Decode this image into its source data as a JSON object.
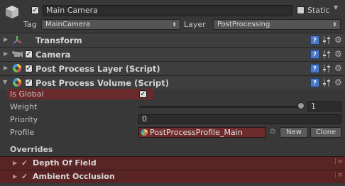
{
  "header": {
    "object_active": true,
    "object_name": "Main Camera",
    "static_label": "Static",
    "tag_label": "Tag",
    "tag_value": "MainCamera",
    "layer_label": "Layer",
    "layer_value": "PostProcessing"
  },
  "components": [
    {
      "title": "Transform",
      "enabled_toggle": false
    },
    {
      "title": "Camera",
      "enabled_toggle": true
    },
    {
      "title": "Post Process Layer (Script)",
      "enabled_toggle": true
    },
    {
      "title": "Post Process Volume (Script)",
      "enabled_toggle": true
    }
  ],
  "volume": {
    "is_global_label": "Is Global",
    "is_global": true,
    "weight_label": "Weight",
    "weight_value": "1",
    "weight_fraction": 1.0,
    "priority_label": "Priority",
    "priority_value": "0",
    "profile_label": "Profile",
    "profile_value": "PostProcessProfile_Main",
    "new_button": "New",
    "clone_button": "Clone"
  },
  "overrides": {
    "title": "Overrides",
    "items": [
      {
        "label": "Depth Of Field",
        "enabled": true
      },
      {
        "label": "Ambient Occlusion",
        "enabled": true
      }
    ]
  },
  "colors": {
    "highlight": "#6a2a2a",
    "override_bg": "#5a2424",
    "help_blue": "#4a79c9"
  }
}
